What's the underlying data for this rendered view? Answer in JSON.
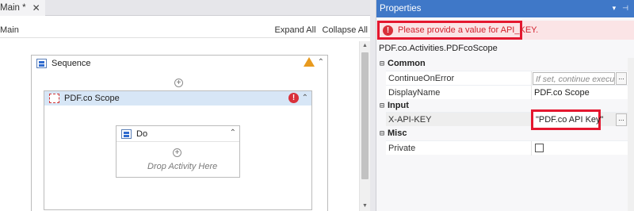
{
  "designer": {
    "tab_title": "Main *",
    "close_glyph": "✕",
    "breadcrumb": "Main",
    "expand_all": "Expand All",
    "collapse_all": "Collapse All"
  },
  "workflow": {
    "sequence_title": "Sequence",
    "scope_title": "PDF.co Scope",
    "do_title": "Do",
    "drop_text": "Drop Activity Here",
    "collapse_glyph": "⌃",
    "plus_glyph": "+",
    "warning_icon": "warning-triangle-icon",
    "error_glyph": "!"
  },
  "properties": {
    "panel_title": "Properties",
    "error_message": "Please provide a value for API_KEY.",
    "type_name": "PDF.co.Activities.PDFcoScope",
    "categories": [
      {
        "label": "Common",
        "toggle": "⊟",
        "rows": [
          {
            "name": "ContinueOnError",
            "placeholder": "If set, continue executing"
          },
          {
            "name": "DisplayName",
            "value": "PDF.co Scope"
          }
        ]
      },
      {
        "label": "Input",
        "toggle": "⊟",
        "rows": [
          {
            "name": "X-API-KEY",
            "value": "\"PDF.co API Key\""
          }
        ]
      },
      {
        "label": "Misc",
        "toggle": "⊟",
        "rows": [
          {
            "name": "Private",
            "checked": false
          }
        ]
      }
    ],
    "ellipsis": "..."
  },
  "colors": {
    "accent": "#3f78c8",
    "error": "#e4172f",
    "warning": "#e89a1e"
  }
}
